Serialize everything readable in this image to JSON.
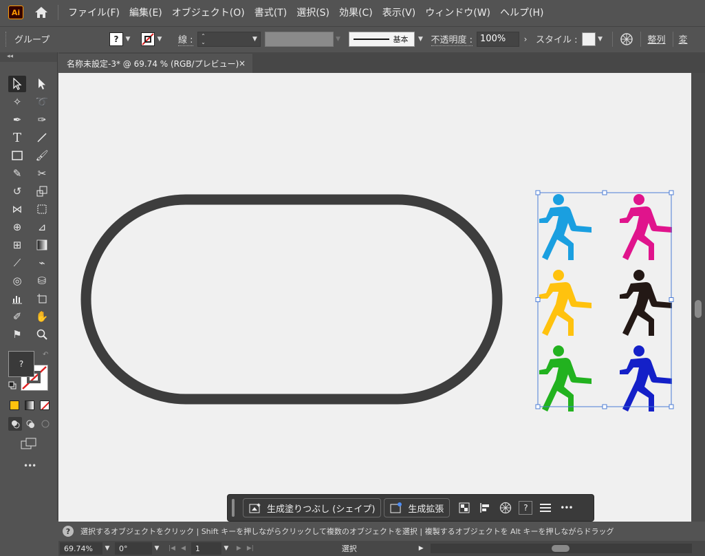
{
  "app": {
    "logo": "Ai",
    "home_icon": "home-icon"
  },
  "menu": [
    "ファイル(F)",
    "編集(E)",
    "オブジェクト(O)",
    "書式(T)",
    "選択(S)",
    "効果(C)",
    "表示(V)",
    "ウィンドウ(W)",
    "ヘルプ(H)"
  ],
  "control": {
    "selection_type": "グループ",
    "stroke_label": "線 :",
    "stroke_profile": "基本",
    "opacity_label": "不透明度 :",
    "opacity_value": "100%",
    "style_label": "スタイル :",
    "align_label": "整列",
    "transform_label": "変",
    "unknown_fill": "?"
  },
  "tab": {
    "title": "名称未設定-3* @ 69.74 % (RGB/プレビュー)",
    "close": "×"
  },
  "toolbar": {
    "unknown_fill": "?",
    "more": "•••"
  },
  "artwork": {
    "stadium_stroke_color": "#3d3d3d",
    "runner_colors": [
      "#1a9fe0",
      "#e0148c",
      "#ffc20e",
      "#231815",
      "#22b21f",
      "#1420c8"
    ],
    "selection_color": "#4a7bd6"
  },
  "taskbar": {
    "generative_fill": "生成塗りつぶし (シェイプ)",
    "generative_expand": "生成拡張",
    "help": "?",
    "more": "•••"
  },
  "hint": {
    "icon": "?",
    "text": "選択するオブジェクトをクリック  |  Shift キーを押しながらクリックして複数のオブジェクトを選択  |  複製するオブジェクトを Alt キーを押しながらドラッグ"
  },
  "status": {
    "zoom": "69.74%",
    "rotation": "0°",
    "artboard": "1",
    "tool_name": "選択"
  }
}
